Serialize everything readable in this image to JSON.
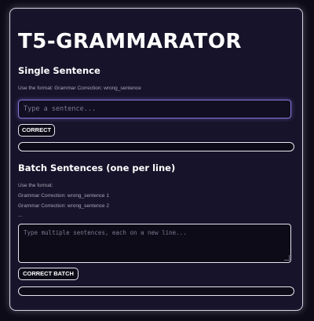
{
  "app": {
    "title": "T5-GRAMMARATOR"
  },
  "single": {
    "heading": "Single Sentence",
    "hint": "Use the format: Grammar Correction: wrong_sentence",
    "input_placeholder": "Type a sentence...",
    "input_value": "",
    "button_label": "CORRECT",
    "output_text": ""
  },
  "batch": {
    "heading": "Batch Sentences (one per line)",
    "hint_lines": [
      "Use the format:",
      "Grammar Correction: wrong_sentence 1",
      "Grammar Correction: wrong_sentence 2",
      "..."
    ],
    "input_placeholder": "Type multiple sentences, each on a new line...",
    "input_value": "",
    "button_label": "CORRECT BATCH",
    "output_text": ""
  },
  "colors": {
    "background": "#0d0b17",
    "card": "#17132a",
    "accent_focus": "#8877d6",
    "border": "#e8e6f0",
    "text": "#ffffff",
    "muted_text": "#a9a6b8"
  }
}
